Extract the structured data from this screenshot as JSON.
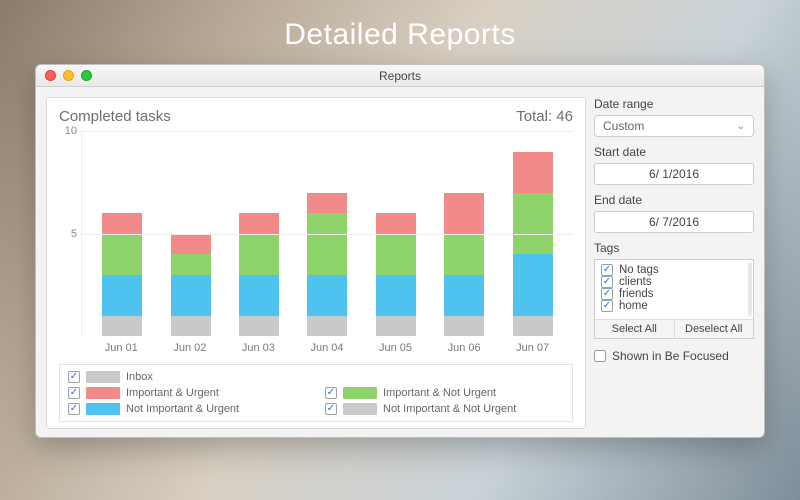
{
  "page_heading": "Detailed Reports",
  "window": {
    "title": "Reports"
  },
  "chart": {
    "title": "Completed tasks",
    "total_label": "Total: 46"
  },
  "chart_data": {
    "type": "bar",
    "stacked": true,
    "title": "Completed tasks",
    "xlabel": "",
    "ylabel": "",
    "ylim": [
      0,
      10
    ],
    "yticks": [
      5,
      10
    ],
    "categories": [
      "Jun 01",
      "Jun 02",
      "Jun 03",
      "Jun 04",
      "Jun 05",
      "Jun 06",
      "Jun 07"
    ],
    "series": [
      {
        "name": "Inbox",
        "color": "#c9c9c9",
        "values": [
          1,
          1,
          1,
          1,
          1,
          1,
          1
        ]
      },
      {
        "name": "Not Important & Urgent",
        "color": "#4fc3ef",
        "values": [
          2,
          2,
          2,
          2,
          2,
          2,
          3
        ]
      },
      {
        "name": "Important & Not Urgent",
        "color": "#8fd46a",
        "values": [
          2,
          1,
          2,
          3,
          2,
          2,
          3
        ]
      },
      {
        "name": "Important & Urgent",
        "color": "#f38a8a",
        "values": [
          1,
          1,
          1,
          1,
          1,
          2,
          2
        ]
      }
    ],
    "total": 46
  },
  "legend": {
    "items": [
      {
        "key": "inbox",
        "label": "Inbox",
        "color": "#c9c9c9",
        "checked": true
      },
      {
        "key": "iu",
        "label": "Important & Urgent",
        "color": "#f38a8a",
        "checked": true
      },
      {
        "key": "inu",
        "label": "Important & Not Urgent",
        "color": "#8fd46a",
        "checked": true
      },
      {
        "key": "niu",
        "label": "Not Important & Urgent",
        "color": "#4fc3ef",
        "checked": true
      },
      {
        "key": "ninu",
        "label": "Not Important & Not Urgent",
        "color": "#c9c9c9",
        "checked": true
      }
    ]
  },
  "controls": {
    "date_range_label": "Date range",
    "date_range_value": "Custom",
    "start_label": "Start date",
    "start_value": "6/ 1/2016",
    "end_label": "End date",
    "end_value": "6/ 7/2016",
    "tags_label": "Tags",
    "tags": [
      {
        "label": "No tags",
        "checked": true
      },
      {
        "label": "clients",
        "checked": true
      },
      {
        "label": "friends",
        "checked": true
      },
      {
        "label": "home",
        "checked": true
      }
    ],
    "select_all": "Select All",
    "deselect_all": "Deselect All",
    "shown_label": "Shown in Be Focused",
    "shown_checked": false
  }
}
